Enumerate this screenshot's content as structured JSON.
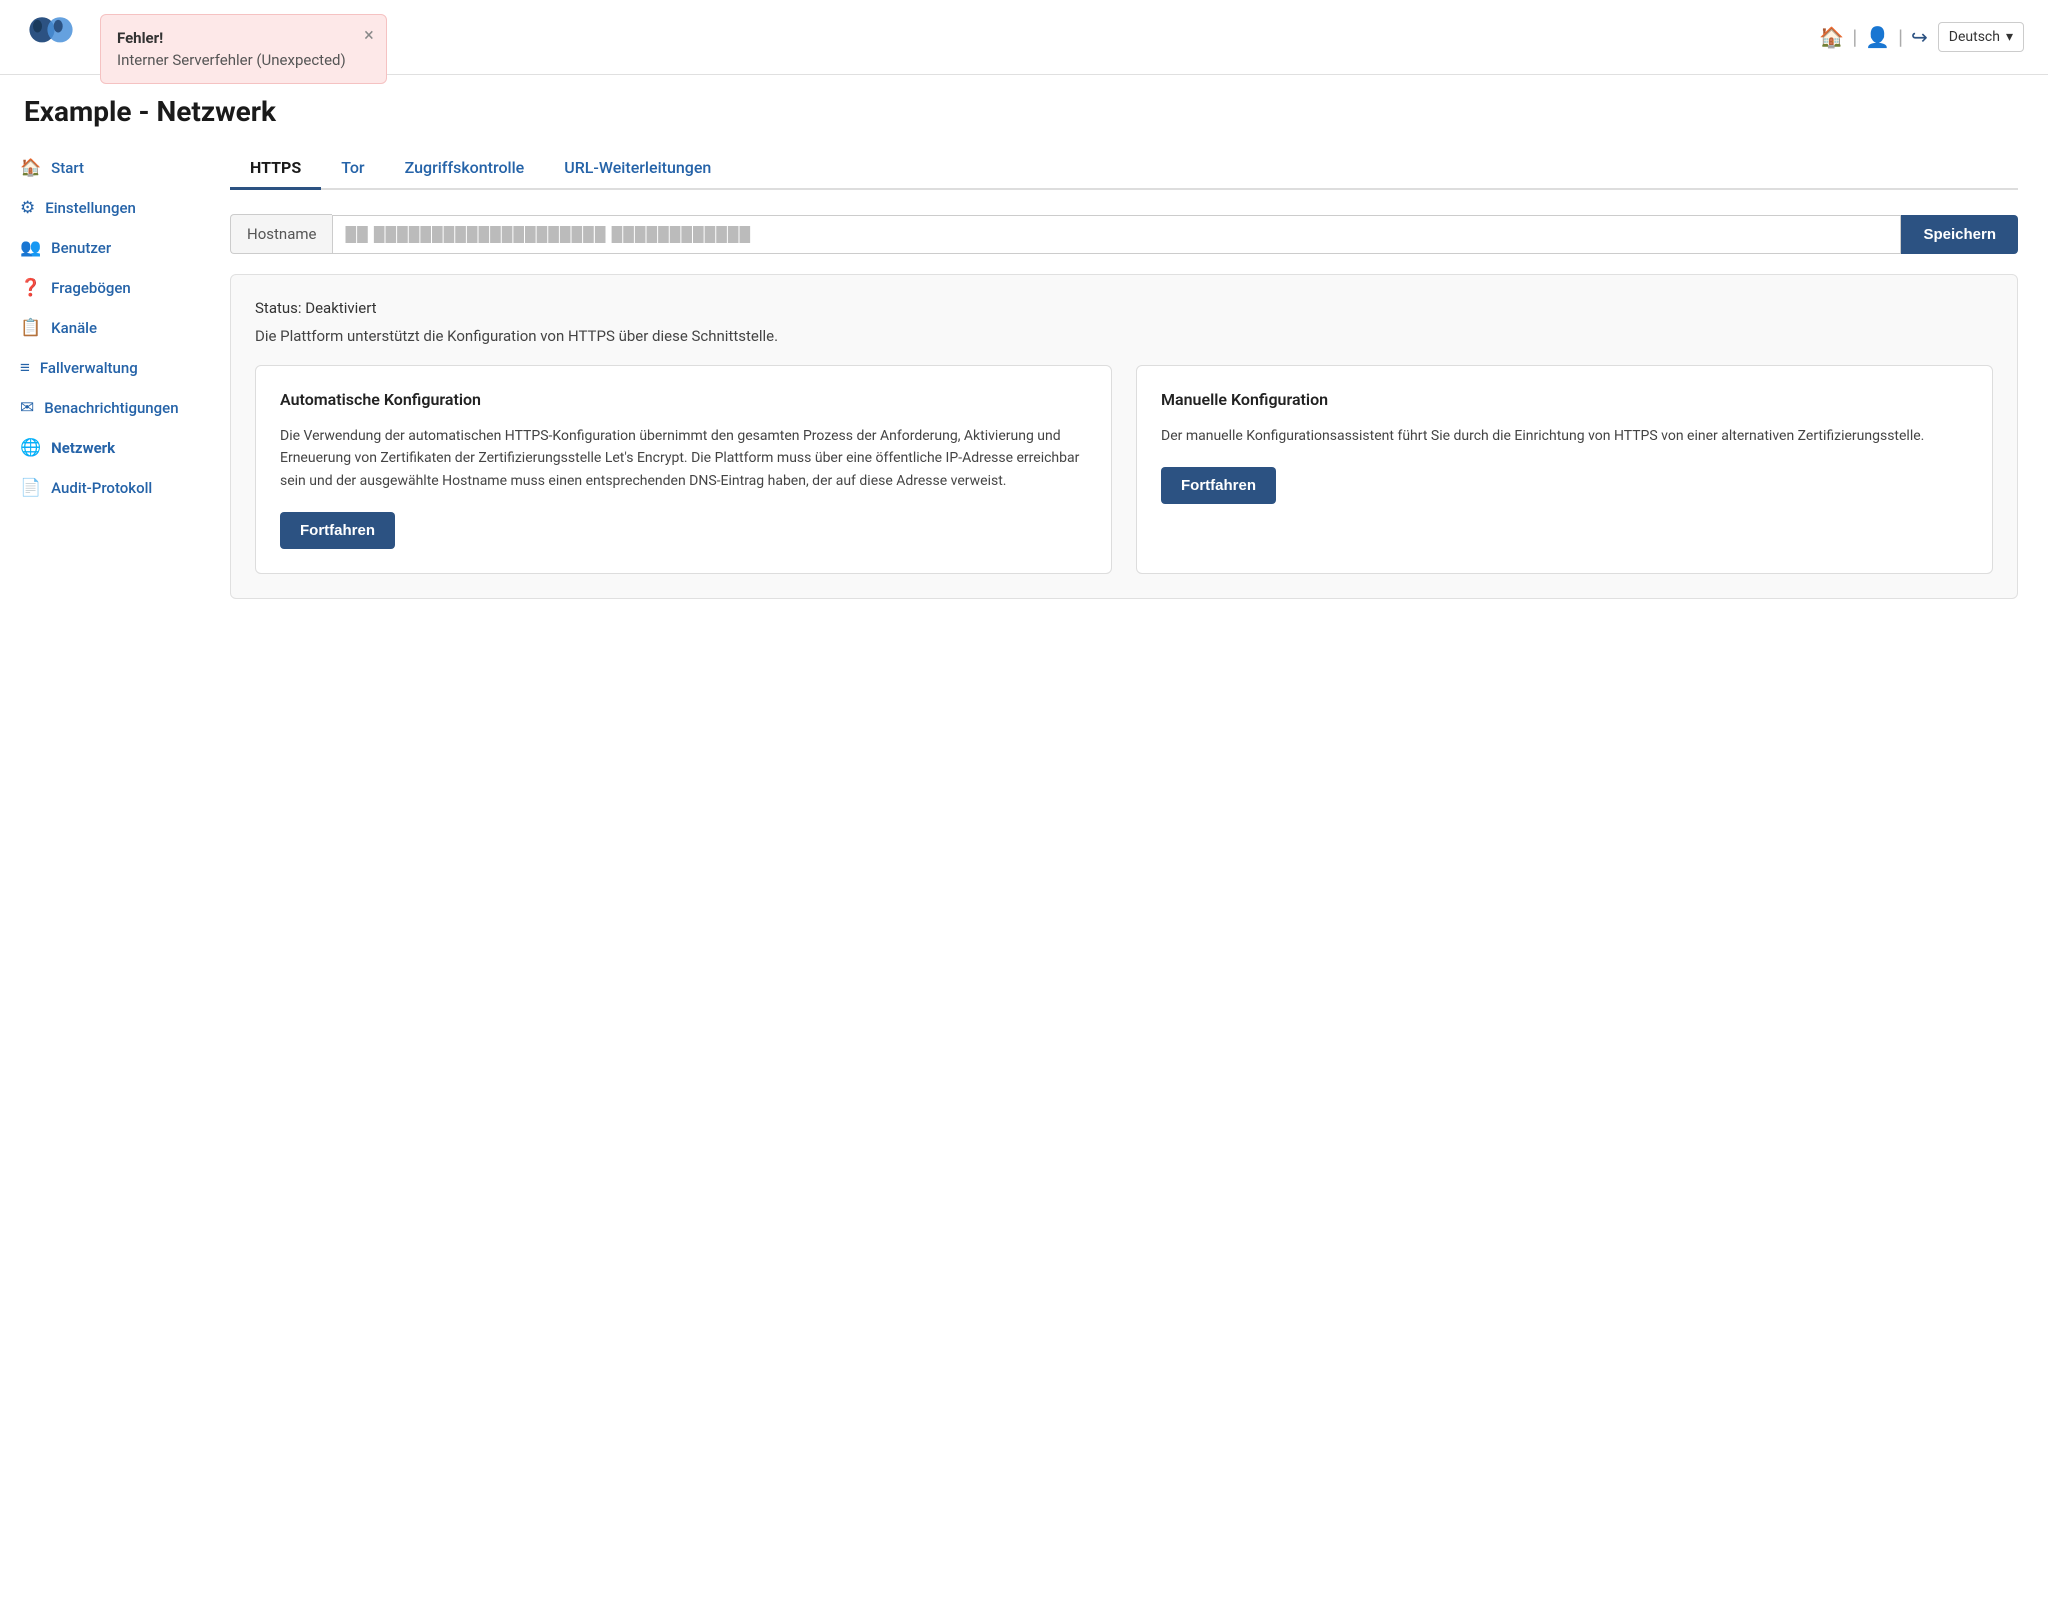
{
  "header": {
    "title": "Example - Netzwerk",
    "lang_label": "Deutsch"
  },
  "error": {
    "title": "Fehler!",
    "message": "Interner Serverfehler (Unexpected)",
    "close_label": "×"
  },
  "sidebar": {
    "items": [
      {
        "id": "start",
        "label": "Start",
        "icon": "🏠"
      },
      {
        "id": "einstellungen",
        "label": "Einstellungen",
        "icon": "⚙"
      },
      {
        "id": "benutzer",
        "label": "Benutzer",
        "icon": "👥"
      },
      {
        "id": "fragebögen",
        "label": "Fragebögen",
        "icon": "❓"
      },
      {
        "id": "kanäle",
        "label": "Kanäle",
        "icon": "📋"
      },
      {
        "id": "fallverwaltung",
        "label": "Fallverwaltung",
        "icon": "≡"
      },
      {
        "id": "benachrichtigungen",
        "label": "Benachrichtigungen",
        "icon": "✉"
      },
      {
        "id": "netzwerk",
        "label": "Netzwerk",
        "icon": "🌐",
        "active": true
      },
      {
        "id": "audit-protokoll",
        "label": "Audit-Protokoll",
        "icon": "📄"
      }
    ]
  },
  "tabs": [
    {
      "id": "https",
      "label": "HTTPS",
      "active": true
    },
    {
      "id": "tor",
      "label": "Tor"
    },
    {
      "id": "zugriffskontrolle",
      "label": "Zugriffskontrolle"
    },
    {
      "id": "url-weiterleitungen",
      "label": "URL-Weiterleitungen"
    }
  ],
  "hostname": {
    "label": "Hostname",
    "value": "██ ████████████████████ ████████████",
    "placeholder": "",
    "save_label": "Speichern"
  },
  "status": {
    "status_text": "Status: Deaktiviert",
    "description": "Die Plattform unterstützt die Konfiguration von HTTPS über diese Schnittstelle."
  },
  "cards": [
    {
      "id": "auto",
      "title": "Automatische Konfiguration",
      "body": "Die Verwendung der automatischen HTTPS-Konfiguration übernimmt den gesamten Prozess der Anforderung, Aktivierung und Erneuerung von Zertifikaten der Zertifizierungsstelle Let's Encrypt. Die Plattform muss über eine öffentliche IP-Adresse erreichbar sein und der ausgewählte Hostname muss einen entsprechenden DNS-Eintrag haben, der auf diese Adresse verweist.",
      "button_label": "Fortfahren"
    },
    {
      "id": "manual",
      "title": "Manuelle Konfiguration",
      "body": "Der manuelle Konfigurationsassistent führt Sie durch die Einrichtung von HTTPS von einer alternativen Zertifizierungsstelle.",
      "button_label": "Fortfahren"
    }
  ]
}
